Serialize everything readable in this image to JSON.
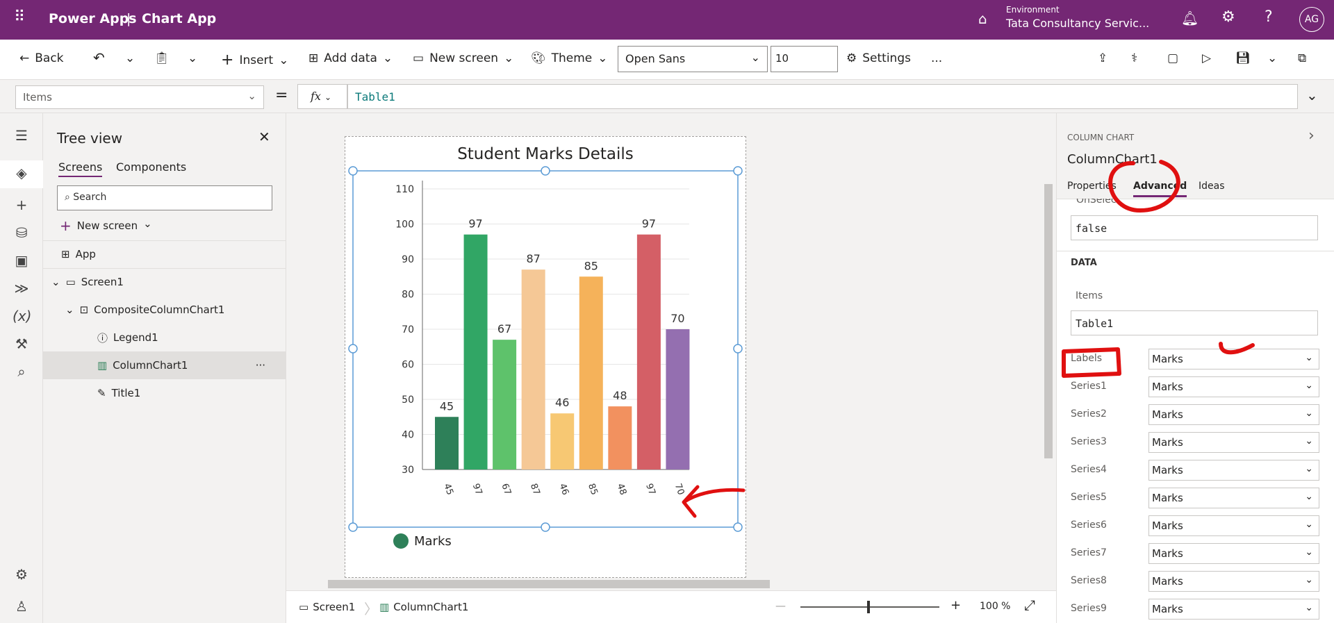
{
  "topbar": {
    "app": "Power Apps",
    "separator": "|",
    "title": "Chart App",
    "env_label": "Environment",
    "env_name": "Tata Consultancy Servic...",
    "avatar": "AG"
  },
  "toolbar": {
    "back": "Back",
    "insert": "Insert",
    "add_data": "Add data",
    "new_screen": "New screen",
    "theme": "Theme",
    "font": "Open Sans",
    "font_size": "10",
    "settings": "Settings",
    "more": "..."
  },
  "formula": {
    "property": "Items",
    "equals": "=",
    "fx": "fx",
    "value": "Table1"
  },
  "tree": {
    "title": "Tree view",
    "tabs": [
      "Screens",
      "Components"
    ],
    "search_placeholder": "Search",
    "new_screen": "New screen",
    "app": "App",
    "nodes": [
      "Screen1",
      "CompositeColumnChart1",
      "Legend1",
      "ColumnChart1",
      "Title1"
    ],
    "more": "···"
  },
  "chart_data": {
    "type": "bar",
    "title": "Student Marks Details",
    "categories": [
      "45",
      "97",
      "67",
      "87",
      "46",
      "85",
      "48",
      "97",
      "70"
    ],
    "values": [
      45,
      97,
      67,
      87,
      46,
      85,
      48,
      97,
      70
    ],
    "ylim": [
      30,
      110
    ],
    "yticks": [
      30,
      40,
      50,
      60,
      70,
      80,
      90,
      100,
      110
    ],
    "colors": [
      "#2e8059",
      "#31a665",
      "#5ec26b",
      "#f5c896",
      "#f7c873",
      "#f5b25a",
      "#f2915f",
      "#d45f66",
      "#946fb0"
    ],
    "legend": "Marks",
    "legend_color": "#2e8059",
    "grid": true
  },
  "status": {
    "screen": "Screen1",
    "control": "ColumnChart1",
    "zoom": "100 %",
    "minus": "—",
    "plus": "+"
  },
  "panel": {
    "type": "COLUMN CHART",
    "name": "ColumnChart1",
    "tabs": [
      "Properties",
      "Advanced",
      "Ideas"
    ],
    "onselect_label": "OnSelect",
    "onselect": "false",
    "data_header": "DATA",
    "items_label": "Items",
    "items": "Table1",
    "rows": [
      {
        "label": "Labels",
        "value": "Marks"
      },
      {
        "label": "Series1",
        "value": "Marks"
      },
      {
        "label": "Series2",
        "value": "Marks"
      },
      {
        "label": "Series3",
        "value": "Marks"
      },
      {
        "label": "Series4",
        "value": "Marks"
      },
      {
        "label": "Series5",
        "value": "Marks"
      },
      {
        "label": "Series6",
        "value": "Marks"
      },
      {
        "label": "Series7",
        "value": "Marks"
      },
      {
        "label": "Series8",
        "value": "Marks"
      },
      {
        "label": "Series9",
        "value": "Marks"
      }
    ]
  }
}
